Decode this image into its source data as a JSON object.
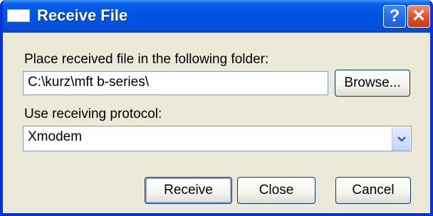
{
  "window": {
    "title": "Receive File",
    "help_glyph": "?",
    "close_glyph": "✕"
  },
  "folder": {
    "label": "Place received file in the following folder:",
    "value": "C:\\kurz\\mft b-series\\",
    "browse_label": "Browse..."
  },
  "protocol": {
    "label": "Use receiving protocol:",
    "selected": "Xmodem"
  },
  "actions": {
    "receive_label": "Receive",
    "close_label": "Close",
    "cancel_label": "Cancel"
  },
  "colors": {
    "titlebar": "#0054e3",
    "frame": "#0831d9",
    "dialog_bg": "#ece9d8",
    "close_button": "#e0542a"
  },
  "icons": [
    "window-icon",
    "help-icon",
    "close-icon",
    "chevron-down-icon"
  ]
}
